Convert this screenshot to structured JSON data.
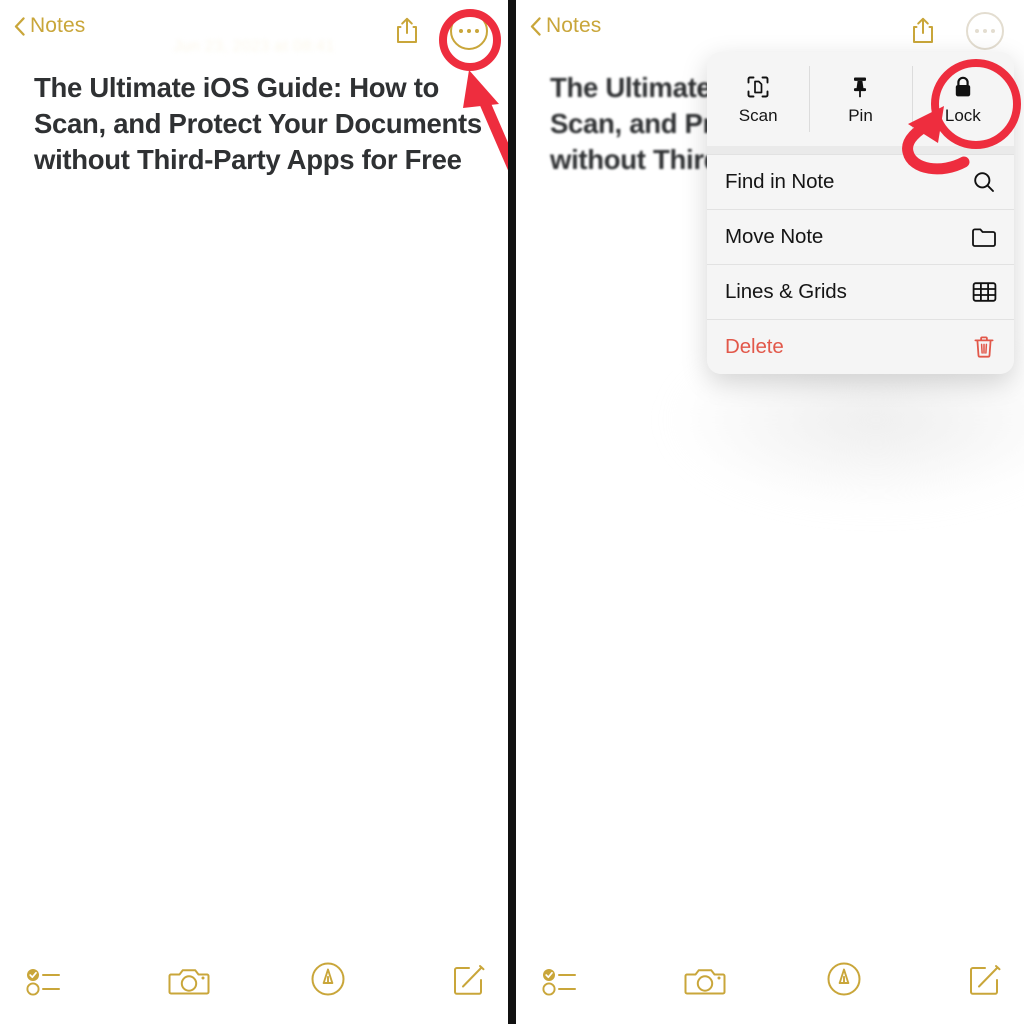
{
  "app": {
    "name": "Apple Notes",
    "accent_gold": "#c9a63a",
    "annotation_red": "#ee2d3e",
    "delete_red": "#e2584a"
  },
  "panels": [
    {
      "id": "left",
      "navbar": {
        "back_label": "Notes",
        "back_icon": "chevron-left-icon",
        "share_icon": "share-icon",
        "more_icon": "ellipsis-circle-icon",
        "more_highlighted": true
      },
      "date_line": "Jun 23, 2023 at 08:41",
      "title_lines": [
        "The Ultimate iOS Guide: How to",
        "Scan, and Protect Your Documents",
        "without Third-Party Apps for Free"
      ],
      "menu_open": false,
      "annotation": {
        "shape": "circle-with-arrow",
        "target": "ellipsis-circle-icon",
        "color": "#ee2d3e"
      }
    },
    {
      "id": "right",
      "navbar": {
        "back_label": "Notes",
        "back_icon": "chevron-left-icon",
        "share_icon": "share-icon",
        "more_icon": "ellipsis-circle-icon",
        "more_highlighted": false
      },
      "date_line": "",
      "title_lines": [
        "The Ultimate",
        "Scan, and Pr",
        "without Third"
      ],
      "menu_open": true,
      "annotation": {
        "shape": "circle-with-curved-arrow",
        "target": "lock-action",
        "color": "#ee2d3e"
      }
    }
  ],
  "context_menu": {
    "top_actions": [
      {
        "label": "Scan",
        "icon": "document-scan-icon"
      },
      {
        "label": "Pin",
        "icon": "pushpin-icon"
      },
      {
        "label": "Lock",
        "icon": "padlock-icon",
        "highlighted": true
      }
    ],
    "rows": [
      {
        "label": "Find in Note",
        "icon": "search-icon",
        "destructive": false
      },
      {
        "label": "Move Note",
        "icon": "folder-icon",
        "destructive": false
      },
      {
        "label": "Lines & Grids",
        "icon": "grid-icon",
        "destructive": false
      },
      {
        "label": "Delete",
        "icon": "trash-icon",
        "destructive": true
      }
    ]
  },
  "toolbar": {
    "items": [
      {
        "name": "checklist-icon",
        "label": "Checklist"
      },
      {
        "name": "camera-icon",
        "label": "Camera"
      },
      {
        "name": "markup-pen-icon",
        "label": "Markup"
      },
      {
        "name": "compose-icon",
        "label": "Compose"
      }
    ]
  }
}
